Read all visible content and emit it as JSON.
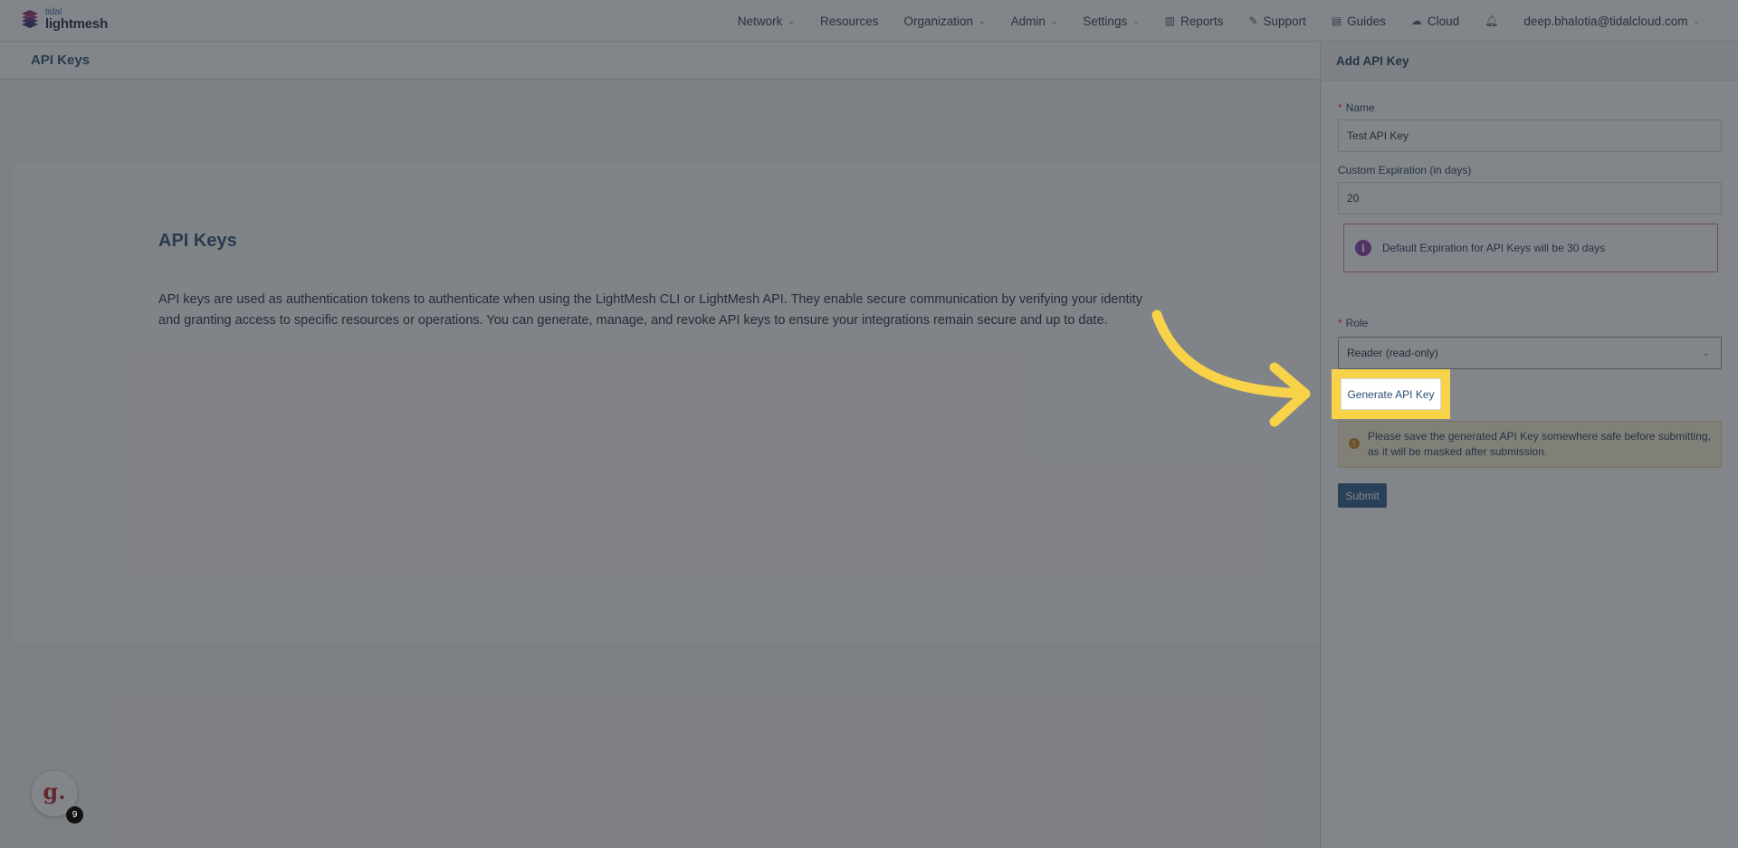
{
  "logo": {
    "small": "tidal",
    "big": "lightmesh"
  },
  "nav": {
    "network": "Network",
    "resources": "Resources",
    "organization": "Organization",
    "admin": "Admin",
    "settings": "Settings",
    "reports": "Reports",
    "support": "Support",
    "guides": "Guides",
    "cloud": "Cloud",
    "user": "deep.bhalotia@tidalcloud.com"
  },
  "subheader": {
    "title": "API Keys"
  },
  "content": {
    "title": "API Keys",
    "description_line1": "API keys are used as authentication tokens to authenticate when using the LightMesh CLI or LightMesh API. They enable secure communication by verifying your identity",
    "description_line2": "and granting access to specific resources or operations. You can generate, manage, and revoke API keys to ensure your integrations remain secure and up to date."
  },
  "drawer": {
    "title": "Add API Key",
    "name_label": "Name",
    "name_value": "Test API Key",
    "expiration_label": "Custom Expiration (in days)",
    "expiration_value": "20",
    "info_text": "Default Expiration for API Keys will be 30 days",
    "role_label": "Role",
    "role_value": "Reader (read-only)",
    "generate_label": "Generate API Key",
    "warn_line1": "Please save the generated API Key somewhere safe before submitting,",
    "warn_line2": "as it will be masked after submission.",
    "submit_label": "Submit"
  },
  "widget": {
    "glyph": "g.",
    "badge": "9"
  },
  "colors": {
    "highlight": "#f8d34a",
    "primary": "#2d5b8c",
    "accent_purple": "#8c3fa5"
  }
}
